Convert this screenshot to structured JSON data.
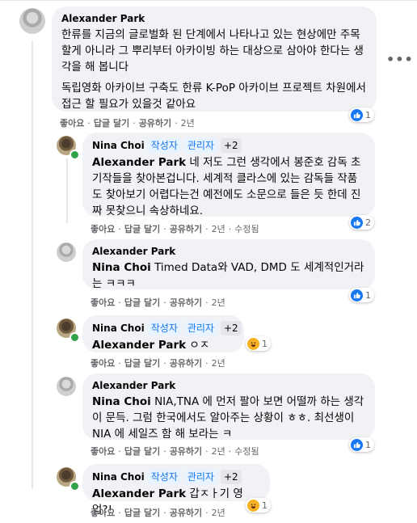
{
  "comments": [
    {
      "author": "Alexander Park",
      "paragraphs": [
        "한류를 지금의 글로벌화 된 단계에서 나타나고 있는 현상에만 주목 할게 아니라 그 뿌리부터 아카이빙 하는 대상으로 삼아야 한다는 생각을 해 봅니다",
        "독립영화 아카이브 구축도 한류 K-PoP 아카이브 프로젝트 차원에서 접근 할 필요가 있을것 같아요"
      ],
      "actions": [
        "좋아요",
        "답글 달기",
        "공유하기",
        "2년"
      ],
      "reaction": {
        "type": "like",
        "count": "1"
      }
    },
    {
      "author": "Nina Choi",
      "badges": [
        "작성자",
        "관리자",
        "+2"
      ],
      "mention": "Alexander Park",
      "text": " 네 저도 그런 생각에서 봉준호 감독 초기작들을 찾아본겁니다. 세계적 클라스에 있는 감독들 작품도 찾아보기 어렵다는건 예전에도 소문으로 들은 듯 한데 진짜 못찾으니 속상하네요.",
      "actions": [
        "좋아요",
        "답글 달기",
        "공유하기",
        "2년",
        "수정됨"
      ],
      "reaction": {
        "type": "like",
        "count": "2"
      }
    },
    {
      "author": "Alexander Park",
      "mention": "Nina Choi",
      "text": " Timed Data와 VAD, DMD 도 세계적인거라는 ㅋㅋㅋ",
      "actions": [
        "좋아요",
        "답글 달기",
        "공유하기",
        "2년"
      ],
      "reaction": {
        "type": "like",
        "count": "1"
      }
    },
    {
      "author": "Nina Choi",
      "badges": [
        "작성자",
        "관리자",
        "+2"
      ],
      "mention": "Alexander Park",
      "text": " ㅇㅈ",
      "actions": [
        "좋아요",
        "답글 달기",
        "공유하기",
        "2년"
      ],
      "reaction": {
        "type": "haha",
        "count": "1"
      }
    },
    {
      "author": "Alexander Park",
      "mention": "Nina Choi",
      "text": " NIA,TNA 에 먼저 팔아 보면 어떨까 하는 생각이 문득. 그럼 한국에서도 알아주는 상황이 ㅎㅎ. 최선생이 NIA 에 세일즈 함 해 보라는 ㅋ",
      "actions": [
        "좋아요",
        "답글 달기",
        "공유하기",
        "2년",
        "수정됨"
      ],
      "reaction": {
        "type": "like",
        "count": "1"
      }
    },
    {
      "author": "Nina Choi",
      "badges": [
        "작성자",
        "관리자",
        "+2"
      ],
      "mention": "Alexander Park",
      "text": " 갑ㅈㅏ기 영업?!",
      "actions": [
        "좋아요",
        "답글 달기",
        "공유하기",
        "2년"
      ],
      "reaction": {
        "type": "haha",
        "count": "1"
      }
    }
  ],
  "more_icon": "more-horizontal-icon",
  "colors": {
    "like": "#1877f2",
    "haha": "#f7b125",
    "bubble": "#f0f2f5",
    "badge_text": "#1877f2"
  }
}
